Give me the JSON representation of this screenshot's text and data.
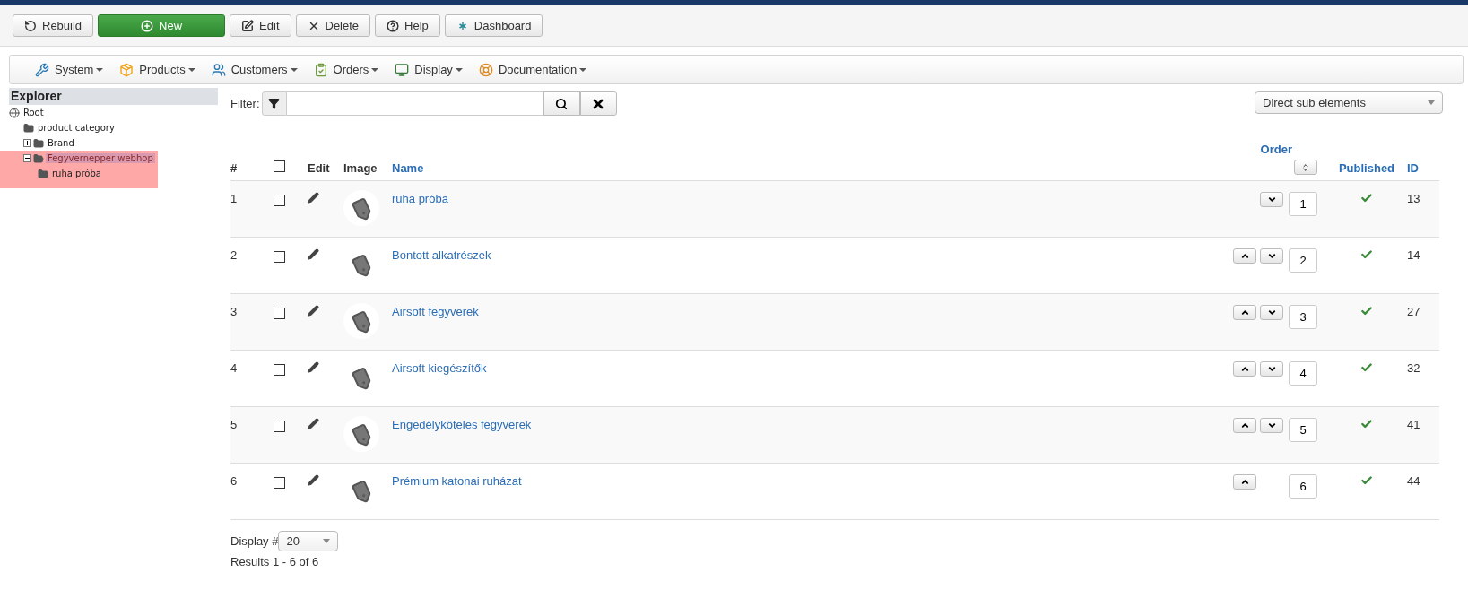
{
  "toolbar": [
    {
      "label": "Rebuild",
      "kind": "rebuild"
    },
    {
      "label": "New",
      "kind": "new"
    },
    {
      "label": "Edit",
      "kind": "edit"
    },
    {
      "label": "Delete",
      "kind": "delete"
    },
    {
      "label": "Help",
      "kind": "help"
    },
    {
      "label": "Dashboard",
      "kind": "dashboard"
    }
  ],
  "menu": [
    {
      "label": "System",
      "kind": "system"
    },
    {
      "label": "Products",
      "kind": "products"
    },
    {
      "label": "Customers",
      "kind": "customers"
    },
    {
      "label": "Orders",
      "kind": "orders"
    },
    {
      "label": "Display",
      "kind": "display"
    },
    {
      "label": "Documentation",
      "kind": "documentation"
    }
  ],
  "explorer": {
    "title": "Explorer",
    "tree": [
      {
        "label": "Root",
        "kind": "root",
        "selected": false,
        "children": [
          {
            "label": "product category",
            "kind": "folder",
            "selected": false
          },
          {
            "label": "Brand",
            "kind": "folder",
            "selected": false,
            "expanded": false
          },
          {
            "label": "Fegyvernepper webhop",
            "kind": "folder",
            "selected": true,
            "expanded": true,
            "children": [
              {
                "label": "ruha próba",
                "kind": "folder",
                "selected": false
              }
            ]
          }
        ]
      }
    ]
  },
  "filter": {
    "label": "Filter:"
  },
  "scope_select": {
    "value": "Direct sub elements"
  },
  "table": {
    "select_all_checked": false,
    "columns": [
      "#",
      "Edit",
      "Image",
      "Name",
      "Order",
      "Published",
      "ID"
    ],
    "rows": [
      {
        "num": "1",
        "checked": false,
        "name": "ruha próba",
        "up": false,
        "down": true,
        "order": "1",
        "published": true,
        "id": "13"
      },
      {
        "num": "2",
        "checked": false,
        "name": "Bontott alkatrészek",
        "up": true,
        "down": true,
        "order": "2",
        "published": true,
        "id": "14"
      },
      {
        "num": "3",
        "checked": false,
        "name": "Airsoft fegyverek",
        "up": true,
        "down": true,
        "order": "3",
        "published": true,
        "id": "27"
      },
      {
        "num": "4",
        "checked": false,
        "name": "Airsoft kiegészítők",
        "up": true,
        "down": true,
        "order": "4",
        "published": true,
        "id": "32"
      },
      {
        "num": "5",
        "checked": false,
        "name": "Engedélyköteles fegyverek",
        "up": true,
        "down": true,
        "order": "5",
        "published": true,
        "id": "41"
      },
      {
        "num": "6",
        "checked": false,
        "name": "Prémium katonai ruházat",
        "up": true,
        "down": false,
        "order": "6",
        "published": true,
        "id": "44"
      }
    ]
  },
  "footer": {
    "display_label": "Display #",
    "display_value": "20",
    "results": "Results 1 - 6 of 6"
  }
}
